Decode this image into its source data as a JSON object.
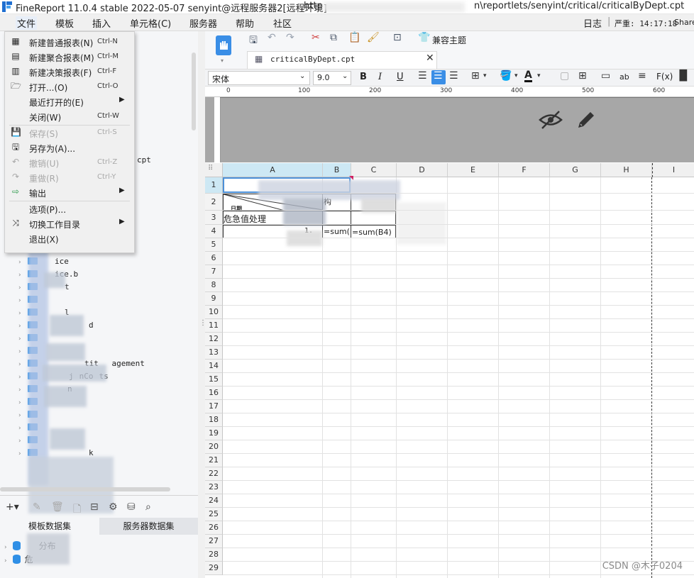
{
  "window": {
    "title": "FineReport 11.0.4 stable 2022-05-07 senyint@远程服务器2[远程环境]",
    "url": "http",
    "url_tail": "n\\reportlets/senyint/critical/criticalByDept.cpt"
  },
  "menubar": {
    "items": [
      "文件",
      "模板",
      "插入",
      "单元格(C)",
      "服务器",
      "帮助",
      "社区"
    ],
    "log": "日志",
    "status": "严重: 14:17:18",
    "share": "Share"
  },
  "file_menu": {
    "items": [
      {
        "label": "新建普通报表(N)",
        "shortcut": "Ctrl-N",
        "icon": "grid-report-icon",
        "glyph": "▦"
      },
      {
        "label": "新建聚合报表(M)",
        "shortcut": "Ctrl-M",
        "icon": "aggregate-report-icon",
        "glyph": "▤"
      },
      {
        "label": "新建决策报表(F)",
        "shortcut": "Ctrl-F",
        "icon": "decision-report-icon",
        "glyph": "▥"
      },
      {
        "label": "打开...(O)",
        "shortcut": "Ctrl-O",
        "icon": "open-folder-icon",
        "glyph": "🗁"
      },
      {
        "label": "最近打开的(E)",
        "shortcut": "",
        "icon": "",
        "glyph": "",
        "submenu": true
      },
      {
        "label": "关闭(W)",
        "shortcut": "Ctrl-W",
        "icon": "",
        "glyph": ""
      },
      {
        "label": "保存(S)",
        "shortcut": "Ctrl-S",
        "icon": "save-icon",
        "glyph": "💾",
        "disabled": true
      },
      {
        "label": "另存为(A)...",
        "shortcut": "",
        "icon": "save-as-icon",
        "glyph": "🖫"
      },
      {
        "label": "撤销(U)",
        "shortcut": "Ctrl-Z",
        "icon": "undo-icon",
        "glyph": "↶",
        "disabled": true
      },
      {
        "label": "重做(R)",
        "shortcut": "Ctrl-Y",
        "icon": "redo-icon",
        "glyph": "↷",
        "disabled": true
      },
      {
        "label": "输出",
        "shortcut": "",
        "icon": "export-icon",
        "glyph": "⇨",
        "submenu": true
      },
      {
        "label": "选项(P)...",
        "shortcut": "",
        "icon": "",
        "glyph": ""
      },
      {
        "label": "切换工作目录",
        "shortcut": "",
        "icon": "switch-dir-icon",
        "glyph": "⤨",
        "submenu": true
      },
      {
        "label": "退出(X)",
        "shortcut": "",
        "icon": "",
        "glyph": ""
      }
    ]
  },
  "tree": {
    "visible_fragments": [
      "cpt",
      "ice",
      "ice.b",
      "t",
      "l",
      "d",
      "tit",
      "agement",
      "j",
      "nCo",
      "ts",
      "n",
      "k"
    ]
  },
  "toolbar": {
    "theme_label": "兼容主题",
    "tab_label": "criticalByDept.cpt"
  },
  "format": {
    "font": "宋体",
    "size": "9.0",
    "bold": "B",
    "italic": "I",
    "underline": "U",
    "text_tool": "ab",
    "formula_tool": "F(x)"
  },
  "ruler": {
    "ticks": [
      "0",
      "100",
      "200",
      "300",
      "400",
      "500",
      "600"
    ]
  },
  "grid": {
    "columns": [
      "A",
      "B",
      "C",
      "D",
      "E",
      "F",
      "G",
      "H",
      "I"
    ],
    "rows": [
      "1",
      "2",
      "3",
      "4",
      "5",
      "6",
      "7",
      "8",
      "9",
      "10",
      "11",
      "12",
      "13",
      "14",
      "15",
      "16",
      "17",
      "18",
      "19",
      "20",
      "21",
      "22",
      "23",
      "24",
      "25",
      "26",
      "27",
      "28",
      "29"
    ],
    "cells": {
      "a2": "日期",
      "a3": "危急值处理",
      "b2": "构",
      "b4": "=sum(",
      "c4": "=sum(B4)",
      "b4_left": "1."
    }
  },
  "left_bottom": {
    "tab_template": "模板数据集",
    "tab_server": "服务器数据集",
    "items": [
      "分布",
      "危"
    ]
  },
  "watermark": "CSDN @木子0204"
}
